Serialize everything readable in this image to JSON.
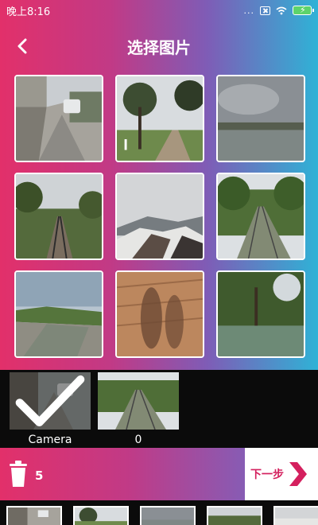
{
  "status_bar": {
    "time": "晚上8:16",
    "signal": "...",
    "battery_icon": "battery-charging-icon"
  },
  "header": {
    "title": "选择图片",
    "back_icon": "back-chevron-icon"
  },
  "grid": {
    "photos": [
      {
        "scene": "alley-with-car"
      },
      {
        "scene": "tree-path"
      },
      {
        "scene": "lake-cloudy"
      },
      {
        "scene": "railway-trees"
      },
      {
        "scene": "broken-roof-mountains"
      },
      {
        "scene": "railway-green-tunnel"
      },
      {
        "scene": "river-canal"
      },
      {
        "scene": "shadow-bricks"
      },
      {
        "scene": "pond-trees"
      }
    ]
  },
  "albums": [
    {
      "name": "Camera",
      "selected": true
    },
    {
      "name": "0",
      "selected": false
    }
  ],
  "action_bar": {
    "selected_count": "5",
    "next_label": "下一步",
    "trash_icon": "trash-icon"
  },
  "selected_tray": {
    "items": 5
  },
  "colors": {
    "gradient_start": "#e2306a",
    "gradient_end": "#2fb2d6",
    "accent": "#d4205e"
  }
}
